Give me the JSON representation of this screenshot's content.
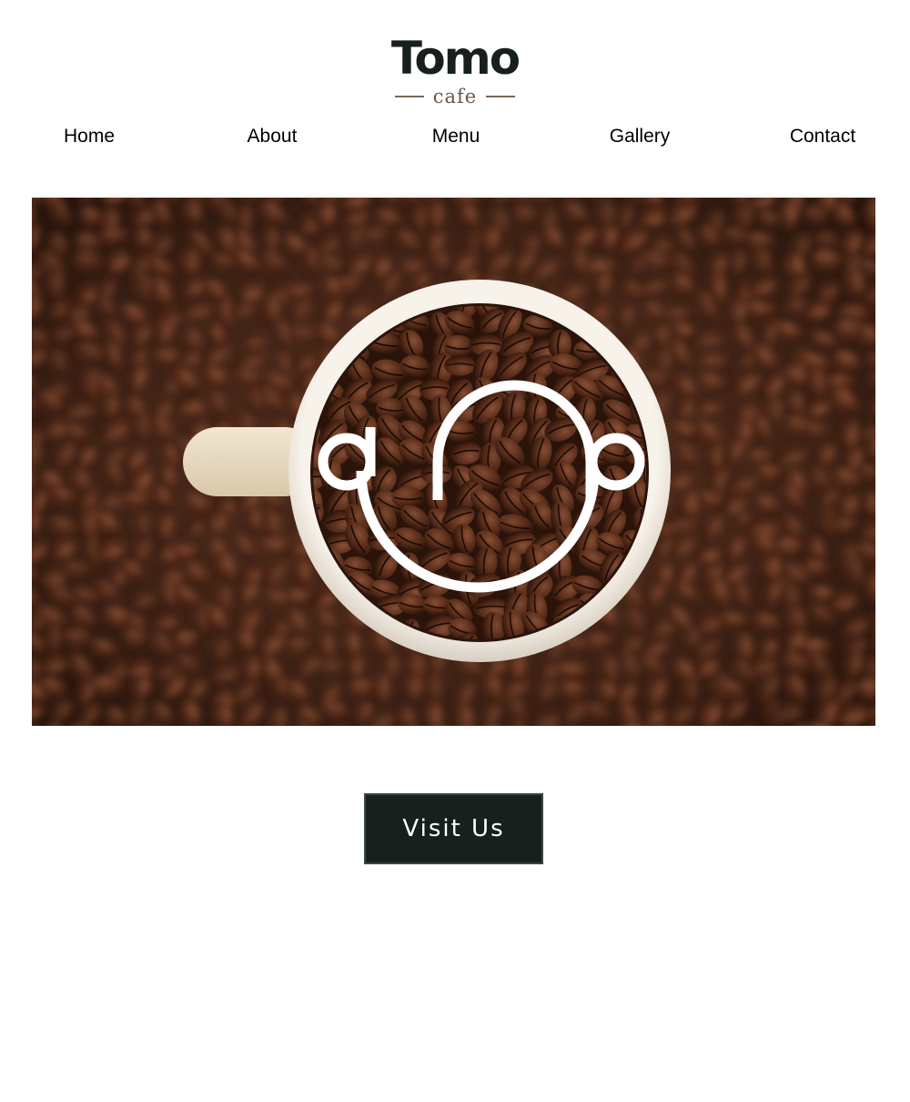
{
  "brand": {
    "name": "Tomo",
    "subtitle": "cafe"
  },
  "nav": {
    "items": [
      {
        "label": "Home"
      },
      {
        "label": "About"
      },
      {
        "label": "Menu"
      },
      {
        "label": "Gallery"
      },
      {
        "label": "Contact"
      }
    ]
  },
  "hero": {
    "image": "coffee-beans-in-white-cup-photo",
    "overlay_icon": "cup-swirl-logo-icon"
  },
  "cta": {
    "label": "Visit Us"
  },
  "colors": {
    "brand_dark": "#17201d",
    "accent_brown": "#6a5648",
    "background": "#ffffff"
  }
}
